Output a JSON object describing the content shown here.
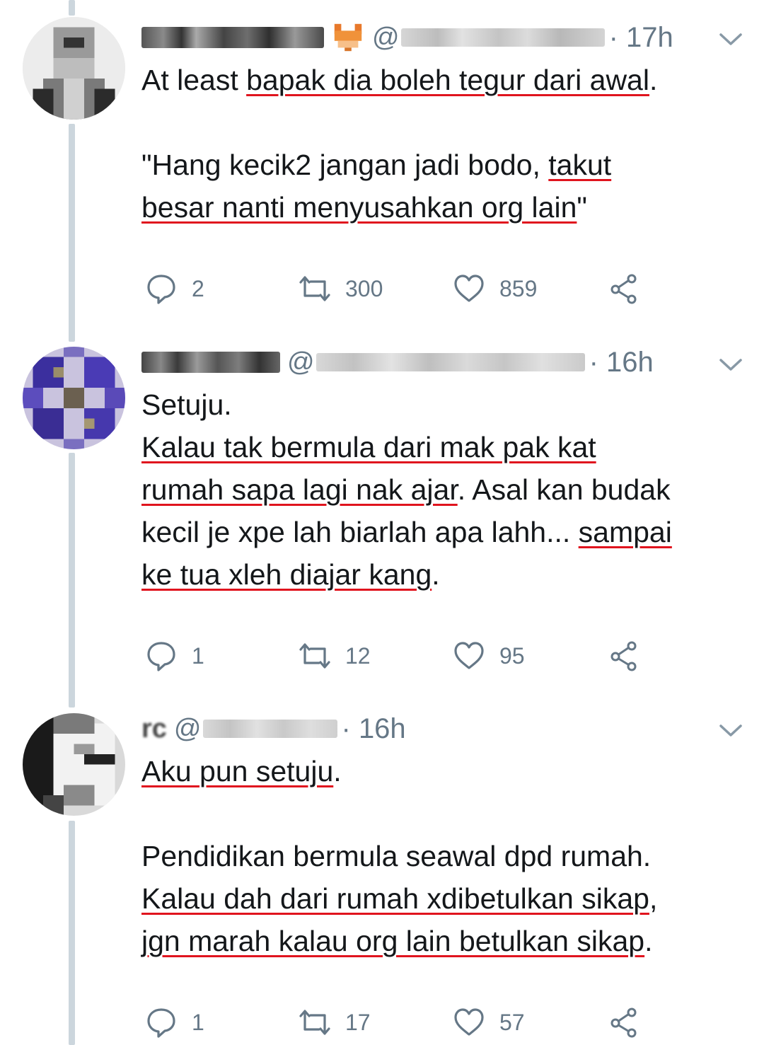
{
  "tweets": [
    {
      "time": "17h",
      "at": "@",
      "body": {
        "p1": {
          "lead": "At least ",
          "u1": "bapak dia boleh tegur dari awal",
          "tail": "."
        },
        "p2": {
          "lead": "\"Hang kecik2 jangan jadi bodo, ",
          "u1": "takut",
          "l2": "besar nanti menyusahkan org lain",
          "tail": "\""
        }
      },
      "counts": {
        "replies": "2",
        "retweets": "300",
        "likes": "859"
      }
    },
    {
      "time": "16h",
      "at": "@",
      "body": {
        "l1": "Setuju.",
        "u1": "Kalau tak bermula dari mak pak kat",
        "u2": "rumah sapa lagi nak ajar",
        "t2": ". Asal kan budak",
        "t3": "kecil je xpe lah biarlah apa lahh... ",
        "u3": "sampai",
        "u4": "ke tua xleh diajar kang",
        "t4": "."
      },
      "counts": {
        "replies": "1",
        "retweets": "12",
        "likes": "95"
      }
    },
    {
      "time": "16h",
      "at": "@",
      "name_visible": "rc",
      "body": {
        "u1": "Aku pun setuju",
        "t1": ".",
        "l3": "Pendidikan bermula seawal dpd rumah.",
        "u2": "Kalau dah dari rumah xdibetulkan sikap",
        "t2": ",",
        "u3": "jgn marah kalau org lain betulkan sikap",
        "t3": "."
      },
      "counts": {
        "replies": "1",
        "retweets": "17",
        "likes": "57"
      }
    }
  ],
  "icons": {
    "reply": "reply-icon",
    "retweet": "retweet-icon",
    "like": "heart-icon",
    "share": "share-icon",
    "more": "chevron-down-icon",
    "badge": "fox-emoji-icon"
  },
  "colors": {
    "text": "#14171a",
    "secondary": "#657786",
    "thread_line": "#ccd6dd",
    "underline": "#e0141e"
  }
}
